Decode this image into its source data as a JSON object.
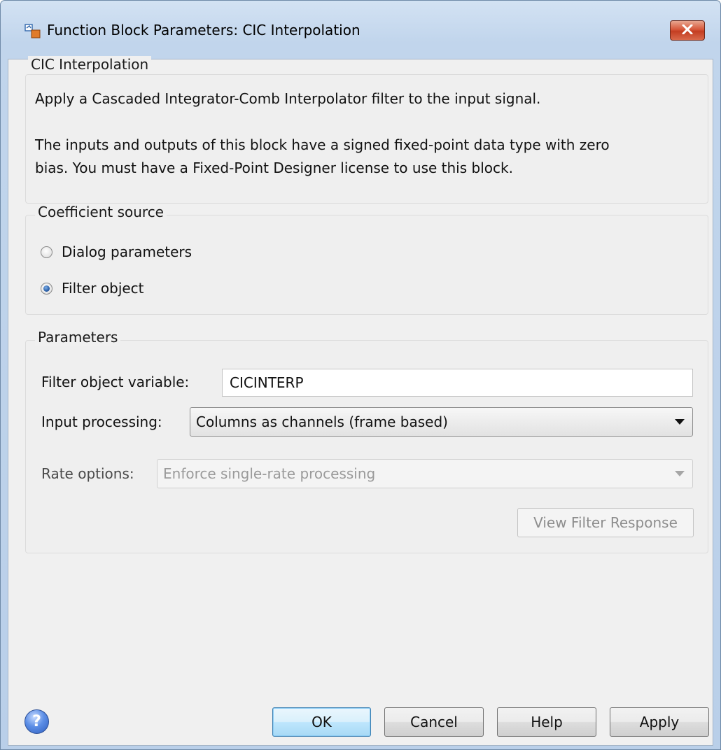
{
  "window": {
    "title": "Function Block Parameters: CIC Interpolation"
  },
  "description_group": {
    "legend": "CIC Interpolation",
    "lines": [
      "Apply a Cascaded Integrator-Comb Interpolator filter to the input signal.",
      "",
      "The inputs and outputs of this block have a signed fixed-point data type with zero",
      "bias. You must have a Fixed-Point Designer license to use this block."
    ]
  },
  "coefficient_source": {
    "legend": "Coefficient source",
    "options": [
      {
        "label": "Dialog parameters",
        "checked": false
      },
      {
        "label": "Filter object",
        "checked": true
      }
    ]
  },
  "parameters": {
    "legend": "Parameters",
    "filter_object_variable": {
      "label": "Filter object variable:",
      "value": "CICINTERP"
    },
    "input_processing": {
      "label": "Input processing:",
      "selected": "Columns as channels (frame based)"
    },
    "rate_options": {
      "label": "Rate options:",
      "selected": "Enforce single-rate processing",
      "enabled": false
    },
    "view_filter_response_label": "View Filter Response"
  },
  "buttons": {
    "ok": "OK",
    "cancel": "Cancel",
    "help": "Help",
    "apply": "Apply"
  },
  "icons": {
    "app": "simulink-block-icon",
    "close": "close-icon",
    "help": "help-icon"
  },
  "colors": {
    "close_button": "#c94a2e",
    "default_button_border": "#3c7fb1",
    "frame": "#c1d5ec"
  }
}
